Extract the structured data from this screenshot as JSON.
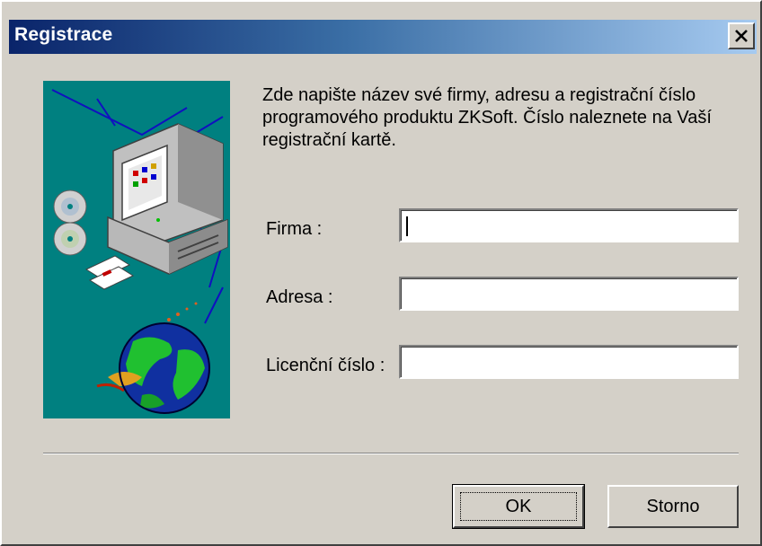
{
  "window": {
    "title": "Registrace",
    "close_glyph": "×"
  },
  "illustration": {
    "icons": [
      "computer-icon",
      "cd-icon",
      "floppy-disk-icon",
      "globe-icon"
    ],
    "background_color": "#008080"
  },
  "description": "Zde napište název své firmy, adresu a registrační číslo programového produktu ZKSoft. Číslo naleznete na Vaší registrační kartě.",
  "form": {
    "firma_label": "Firma :",
    "firma_value": "",
    "adresa_label": "Adresa :",
    "adresa_value": "",
    "licence_label": "Licenční číslo :",
    "licence_value": ""
  },
  "buttons": {
    "ok_label": "OK",
    "cancel_label": "Storno"
  },
  "colors": {
    "title_gradient_start": "#0a246a",
    "title_gradient_end": "#a6caf0",
    "face": "#d4d0c8"
  }
}
